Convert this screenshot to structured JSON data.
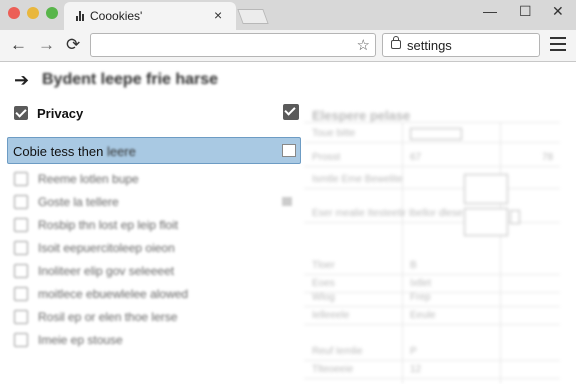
{
  "browser": {
    "tab_title": "Coookies'",
    "tab_close": "×",
    "window_controls": {
      "minimize": "—",
      "maximize": "☐",
      "close": "✕"
    }
  },
  "toolbar": {
    "back_icon": "←",
    "forward_icon": "→",
    "reload_icon": "⟳",
    "omnibox_value": "",
    "star_icon": "☆",
    "secondary_address": "settings"
  },
  "page": {
    "heading_arrow": "➔",
    "heading": "Bydent leepe frie harse",
    "privacy_label": "Privacy",
    "privacy_checked": true,
    "privacy_right_checked": true,
    "highlight": {
      "text_sharp": "Cobie tess then ",
      "text_blur": "leere",
      "checked": false
    },
    "blurred_items": [
      {
        "text": "Reeme lotlen bupe",
        "checked": false
      },
      {
        "text": "Goste la tellere",
        "checked": false,
        "mini": true
      },
      {
        "text": "Rosbip thn lost ep leip floit",
        "checked": false
      },
      {
        "text": "Isoit eepuercitoleep oieon",
        "checked": false
      },
      {
        "text": "Inoliteer elip gov seleeeet",
        "checked": false
      },
      {
        "text": "moitlece ebuewlelee alowed",
        "checked": false
      },
      {
        "text": "Rosil ep or elen thoe lerse",
        "checked": false
      },
      {
        "text": "Imeie ep stouse",
        "checked": false
      }
    ],
    "right_panel": {
      "heading": "Elespere pelase",
      "rows": [
        {
          "label": "Toue bitte",
          "value": ""
        },
        {
          "label": "Prosst",
          "value": "67"
        },
        {
          "label": "Ismtle Eme Bewelite",
          "value": ""
        },
        {
          "label": "Eser mealie Itesteetir Ibellor dlese",
          "value": ""
        },
        {
          "label": "Tloer",
          "value": "B"
        },
        {
          "label": "Eoes",
          "value": "Ixtlet"
        },
        {
          "label": "Wlog",
          "value": "Frep"
        },
        {
          "label": "Ielleeele",
          "value": "Eeule"
        },
        {
          "label": "Reuf Iemlie",
          "value": "P"
        },
        {
          "label": "Tlteoeeie",
          "value": "12"
        }
      ],
      "side_value": "78"
    }
  }
}
